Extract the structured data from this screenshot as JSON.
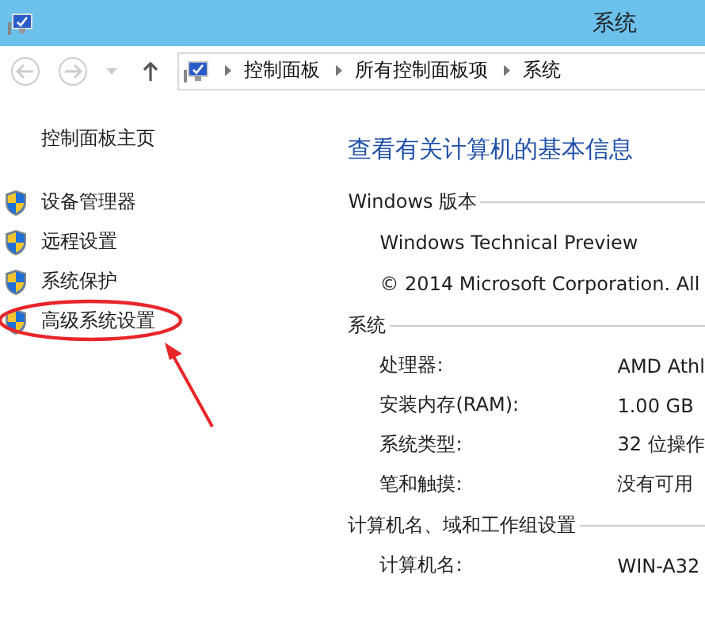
{
  "window": {
    "title": "系统"
  },
  "address_bar": {
    "segments": [
      "控制面板",
      "所有控制面板项",
      "系统"
    ]
  },
  "sidebar": {
    "home": "控制面板主页",
    "items": [
      {
        "label": "设备管理器",
        "highlighted": false
      },
      {
        "label": "远程设置",
        "highlighted": false
      },
      {
        "label": "系统保护",
        "highlighted": false
      },
      {
        "label": "高级系统设置",
        "highlighted": true
      }
    ]
  },
  "main": {
    "heading": "查看有关计算机的基本信息",
    "sections": [
      {
        "title": "Windows 版本",
        "kind": "lines",
        "lines": [
          "Windows Technical Preview",
          "© 2014 Microsoft Corporation. All"
        ]
      },
      {
        "title": "系统",
        "kind": "pairs",
        "rows": [
          {
            "label": "处理器:",
            "value": "AMD Athl"
          },
          {
            "label": "安装内存(RAM):",
            "value": "1.00 GB"
          },
          {
            "label": "系统类型:",
            "value": "32 位操作"
          },
          {
            "label": "笔和触摸:",
            "value": "没有可用"
          }
        ]
      },
      {
        "title": "计算机名、域和工作组设置",
        "kind": "pairs",
        "rows": [
          {
            "label": "计算机名:",
            "value": "WIN-A32"
          }
        ]
      }
    ]
  }
}
